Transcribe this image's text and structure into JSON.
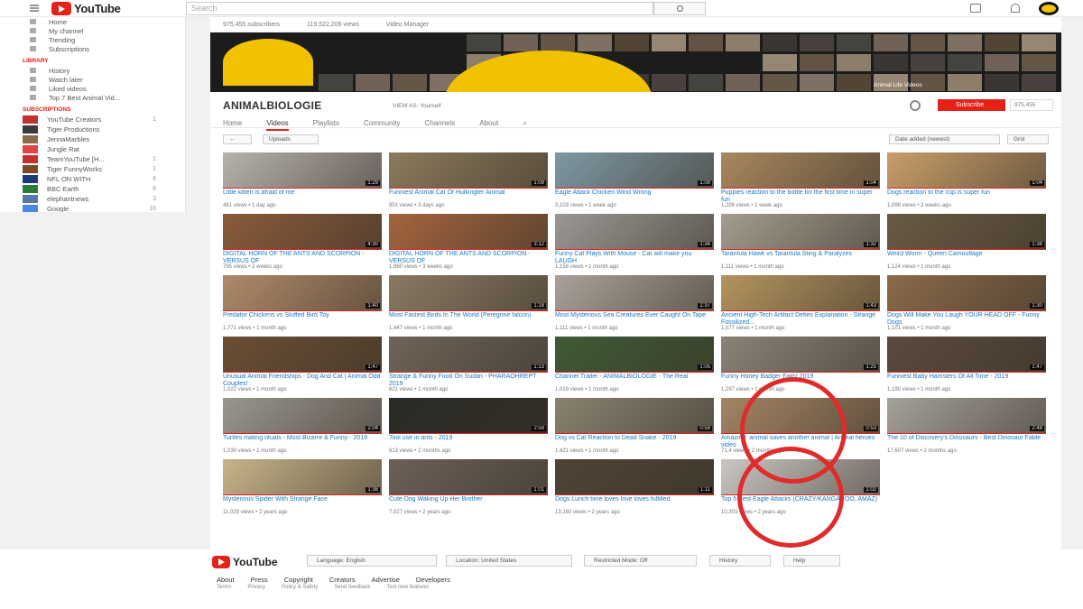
{
  "header": {
    "logo_text": "YouTube",
    "search_placeholder": "Search"
  },
  "sidebar": {
    "items": [
      {
        "label": "Home",
        "icon": "home-icon"
      },
      {
        "label": "My channel",
        "icon": "person-icon"
      },
      {
        "label": "Trending",
        "icon": "fire-icon"
      },
      {
        "label": "Subscriptions",
        "icon": "subscriptions-icon"
      }
    ],
    "library_heading": "LIBRARY",
    "library": [
      {
        "label": "History",
        "icon": "history-icon"
      },
      {
        "label": "Watch later",
        "icon": "clock-icon"
      },
      {
        "label": "Liked videos",
        "icon": "thumbs-up-icon"
      },
      {
        "label": "Top 7 Best Animal Vid...",
        "icon": "playlist-icon"
      }
    ],
    "subscriptions_heading": "SUBSCRIPTIONS",
    "subscriptions": [
      {
        "label": "YouTube Creators",
        "count": "1",
        "color": "#c4302b"
      },
      {
        "label": "Tiger Productions",
        "count": "",
        "color": "#3a3a3a"
      },
      {
        "label": "JennaMarbles",
        "count": "",
        "color": "#8d6b4a"
      },
      {
        "label": "Jungle Rat",
        "count": "",
        "color": "#d44"
      },
      {
        "label": "TeamYouTube [H...",
        "count": "1",
        "color": "#c4302b"
      },
      {
        "label": "Tiger FunnyWorks",
        "count": "1",
        "color": "#7a4a2a"
      },
      {
        "label": "NFL ON WITH",
        "count": "6",
        "color": "#1a3a7a"
      },
      {
        "label": "BBC Earth",
        "count": "8",
        "color": "#2a7a3a"
      },
      {
        "label": "elephantnews",
        "count": "3",
        "color": "#5577aa"
      },
      {
        "label": "Google",
        "count": "16",
        "color": "#4a87e8"
      }
    ]
  },
  "channel": {
    "subscribers": "975,455 subscribers",
    "views": "119,522,209 views",
    "video_manager": "Video Manager",
    "name": "ANIMALBIOLOGIE",
    "view_as_label": "VIEW AS:",
    "view_as_value": "Yourself",
    "subscribe_label": "Subscribe",
    "subscribe_count": "975,455",
    "banner_caption": "Animal Life Videos",
    "tabs": [
      "Home",
      "Videos",
      "Playlists",
      "Community",
      "Channels",
      "About"
    ],
    "active_tab": "Videos"
  },
  "toolbar": {
    "uploads_label": "Uploads",
    "sort_label": "Date added (newest)",
    "view_label": "Grid"
  },
  "videos": [
    {
      "title": "Little kitten is afraid of me",
      "meta": "481 views • 1 day ago",
      "duration": "1:29",
      "color": "#b7b2ad"
    },
    {
      "title": "Funniest Animal Cat Of Hulkingter Animal",
      "meta": "851 views • 3 days ago",
      "duration": "1:09",
      "color": "#8b7a5c"
    },
    {
      "title": "Eagle Attack Chicken Wind Wrong",
      "meta": "3,103 views • 1 week ago",
      "duration": "1:09",
      "color": "#7e98a4"
    },
    {
      "title": "Puppies reaction to the bottle for the first time in super fun",
      "meta": "1,208 views • 1 week ago",
      "duration": "1:04",
      "color": "#a8875e"
    },
    {
      "title": "Dogs reaction to the cup is super fun",
      "meta": "1,098 views • 3 weeks ago",
      "duration": "1:04",
      "color": "#c89e6a"
    },
    {
      "title": "DIGITAL HORN OF THE ANTS AND SCORPION - VERSUS OF",
      "meta": "795 views • 2 weeks ago",
      "duration": "4:30",
      "color": "#8a5a3a"
    },
    {
      "title": "DIGITAL HORN OF THE ANTS AND SCORPION - VERSUS OF",
      "meta": "1,860 views • 3 weeks ago",
      "duration": "3:12",
      "color": "#a4643e"
    },
    {
      "title": "Funny Cat Plays With Mouse - Cat will make you LAUGH",
      "meta": "1,158 views • 1 month ago",
      "duration": "1:34",
      "color": "#9a9894"
    },
    {
      "title": "Tarantula Hawk vs Tarantula Sting & Paralyzes",
      "meta": "1,111 views • 1 month ago",
      "duration": "1:32",
      "color": "#a49c8e"
    },
    {
      "title": "Weird Worm - Queen Camouflage",
      "meta": "1,124 views • 1 month ago",
      "duration": "1:38",
      "color": "#6a5a44"
    },
    {
      "title": "Predator Chickens vs Stuffed Bird Toy",
      "meta": "1,771 views • 1 month ago",
      "duration": "1:40",
      "color": "#b08a6a"
    },
    {
      "title": "Most Fastest Birds In The World (Peregrine falcon)",
      "meta": "1,447 views • 1 month ago",
      "duration": "1:18",
      "color": "#8a7a64"
    },
    {
      "title": "Most Mysterious Sea Creatures Ever Caught On Tape",
      "meta": "1,111 views • 1 month ago",
      "duration": "1:37",
      "color": "#a8a29a"
    },
    {
      "title": "Ancient High-Tech Artifact Defies Explanation - Strange Fossilized...",
      "meta": "1,077 views • 1 month ago",
      "duration": "1:43",
      "color": "#b4945e"
    },
    {
      "title": "Dogs Will Make You Laugh YOUR HEAD OFF - Funny Dogs",
      "meta": "1,101 views • 1 month ago",
      "duration": "1:30",
      "color": "#8a6a4a"
    },
    {
      "title": "Unusual Animal Friendships - Dog And Cat | Animal Odd Couples!",
      "meta": "1,022 views • 1 month ago",
      "duration": "1:47",
      "color": "#6a4e34"
    },
    {
      "title": "Strange & Funny Food On Sudan - PHARAOHREPT 2019",
      "meta": "621 views • 1 month ago",
      "duration": "1:13",
      "color": "#6e6458"
    },
    {
      "title": "Channel Trailer - ANIMALBIOLOGIE - The Real",
      "meta": "1,019 views • 1 month ago",
      "duration": "1:05",
      "color": "#3e5a36"
    },
    {
      "title": "Funny Honey Badger Fails! 2019",
      "meta": "1,297 views • 1 month ago",
      "duration": "1:25",
      "color": "#8a8478"
    },
    {
      "title": "Funniest Baby Hamsters Of All Time - 2019",
      "meta": "1,190 views • 1 month ago",
      "duration": "1:47",
      "color": "#5a4a3e"
    },
    {
      "title": "Turtles mating rituals - Most Bizarre & Funny - 2019",
      "meta": "1,030 views • 1 month ago",
      "duration": "2:04",
      "color": "#9a968e"
    },
    {
      "title": "Tool use in ants - 2019",
      "meta": "613 views • 2 months ago",
      "duration": "2:59",
      "color": "#2a2a26"
    },
    {
      "title": "Dog vs Cat Reaction to Dead Snake - 2019",
      "meta": "1,421 views • 1 month ago",
      "duration": "0:59",
      "color": "#8a8270"
    },
    {
      "title": "Amazing: animal saves another animal | Animal heroes video",
      "meta": "71,4 views • 2 months ago",
      "duration": "0:53",
      "color": "#a48464"
    },
    {
      "title": "The 10 of Discovery's Dinosaurs - Best Dinosaur Fable",
      "meta": "17,607 views • 2 months ago",
      "duration": "2:48",
      "color": "#a4a09a"
    },
    {
      "title": "Mysterious Spider With Strange Face",
      "meta": "11,029 views • 2 years ago",
      "duration": "1:38",
      "color": "#c8b48a"
    },
    {
      "title": "Cute Dog Waking Up Her Brother",
      "meta": "7,027 views • 2 years ago",
      "duration": "1:01",
      "color": "#6a6058"
    },
    {
      "title": "Dogs Lunch time loves love loves fulfilled",
      "meta": "13,160 views • 2 years ago",
      "duration": "1:11",
      "color": "#4e4436"
    },
    {
      "title": "Top 5 Best Eagle Attacks (CRAZY/KANGAROO, AMAZ)",
      "meta": "10,303 views • 2 years ago",
      "duration": "1:02",
      "color": "#cac6c2"
    }
  ],
  "footer": {
    "logo_text": "YouTube",
    "language": "Language: English",
    "location": "Location: United States",
    "restricted": "Restricted Mode: Off",
    "history": "History",
    "help": "Help",
    "links": [
      "About",
      "Press",
      "Copyright",
      "Creators",
      "Advertise",
      "Developers"
    ],
    "links2": [
      "Terms",
      "Privacy",
      "Policy & Safety",
      "Send feedback",
      "Test new features"
    ]
  },
  "annotation_color": "#e02b2b"
}
